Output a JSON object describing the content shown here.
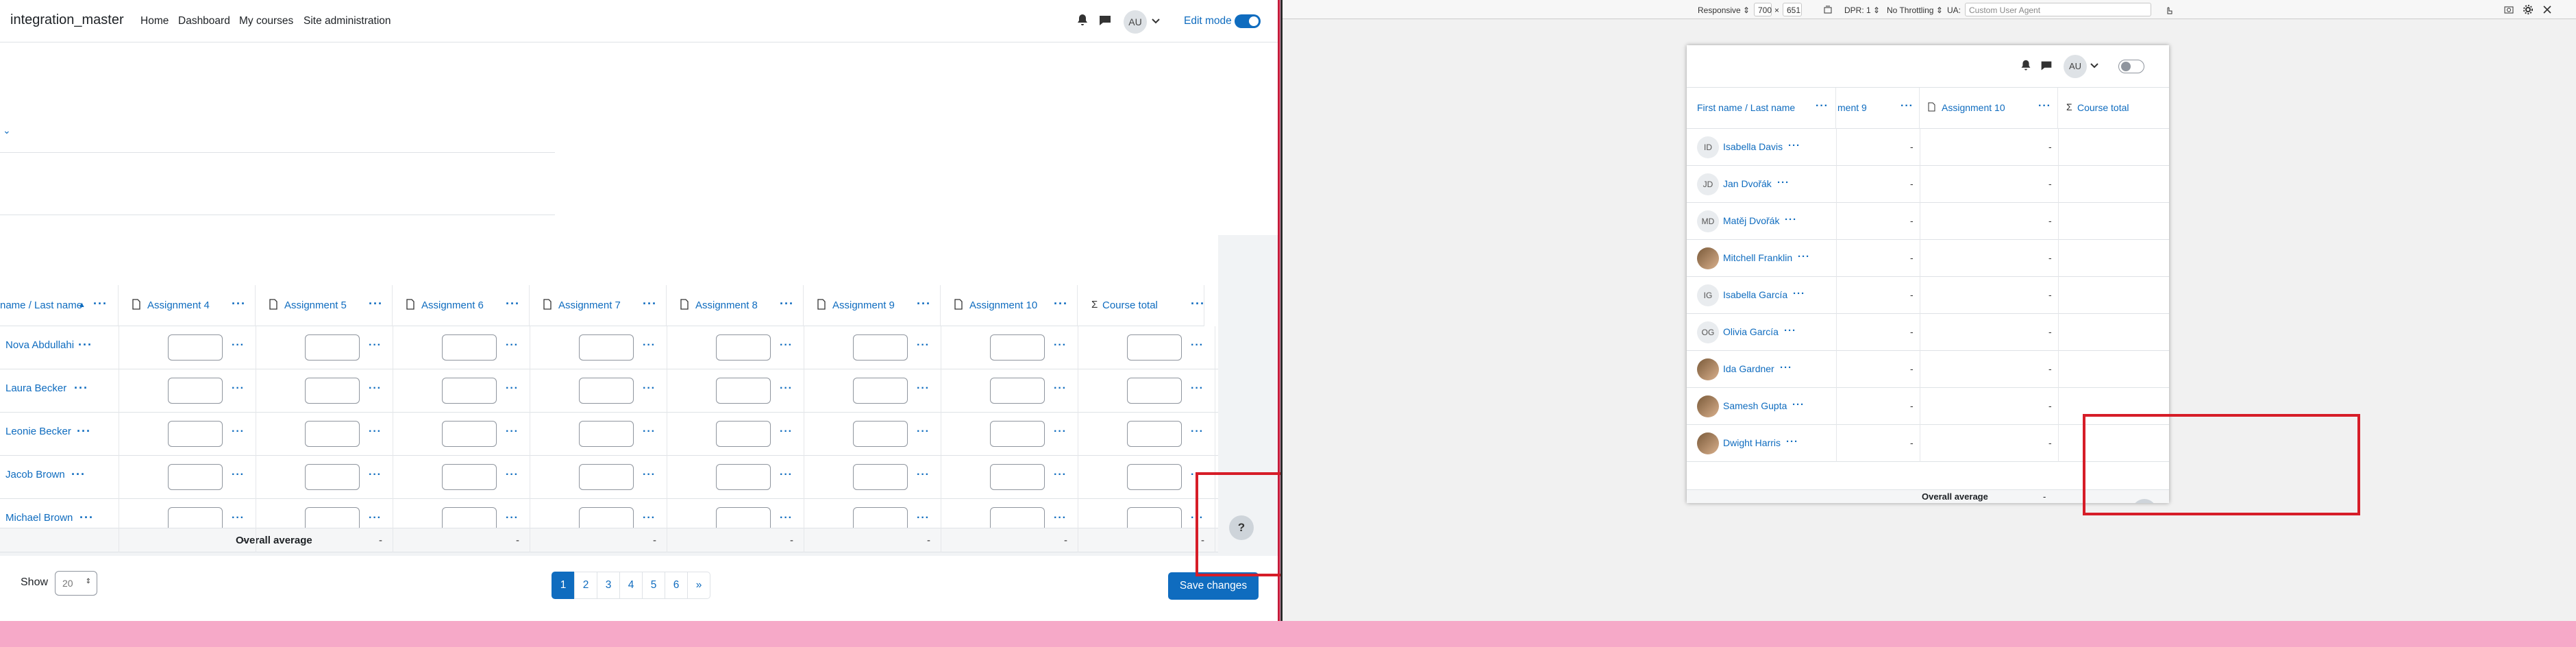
{
  "navbar": {
    "site_name": "integration_master",
    "links": [
      "Home",
      "Dashboard",
      "My courses",
      "Site administration"
    ],
    "avatar_initials": "AU",
    "edit_mode_label": "Edit mode",
    "edit_mode_on": true
  },
  "grader": {
    "name_header": "First name / Last name",
    "name_header_visible": "name / Last name",
    "sort_indicator": "▲",
    "columns": [
      "Assignment 4",
      "Assignment 5",
      "Assignment 6",
      "Assignment 7",
      "Assignment 8",
      "Assignment 9",
      "Assignment 10",
      "Course total"
    ],
    "students": [
      "Nova Abdullahi",
      "Laura Becker",
      "Leonie Becker",
      "Jacob Brown",
      "Michael Brown"
    ],
    "overall_average_label": "Overall average",
    "average_value": "-"
  },
  "footer": {
    "show_label": "Show",
    "per_page": "20",
    "pages": [
      "1",
      "2",
      "3",
      "4",
      "5",
      "6",
      "»"
    ],
    "active_page": "1",
    "save_label": "Save changes"
  },
  "help_label": "?",
  "devtools": {
    "mode": "Responsive ⇕",
    "width": "700",
    "times": "×",
    "height": "651",
    "dpr": "DPR: 1 ⇕",
    "throttle": "No Throttling ⇕",
    "ua_label": "UA:",
    "ua_placeholder": "Custom User Agent"
  },
  "responsive": {
    "avatar_initials": "AU",
    "name_header": "First name / Last name",
    "partial_col": "ment 9",
    "col_a10": "Assignment 10",
    "col_total": "Course total",
    "students": [
      {
        "initials": "ID",
        "name": "Isabella Davis",
        "photo": false
      },
      {
        "initials": "JD",
        "name": "Jan Dvořák",
        "photo": false
      },
      {
        "initials": "MD",
        "name": "Matěj Dvořák",
        "photo": false
      },
      {
        "initials": "",
        "name": "Mitchell Franklin",
        "photo": true
      },
      {
        "initials": "IG",
        "name": "Isabella García",
        "photo": false
      },
      {
        "initials": "OG",
        "name": "Olivia García",
        "photo": false
      },
      {
        "initials": "",
        "name": "Ida Gardner",
        "photo": true
      },
      {
        "initials": "",
        "name": "Samesh Gupta",
        "photo": true
      },
      {
        "initials": "",
        "name": "Dwight Harris",
        "photo": true
      }
    ],
    "overall_average_label": "Overall average",
    "average_value": "-",
    "dash": "-"
  },
  "colors": {
    "accent": "#0f6cbf",
    "highlight": "#d61d28",
    "backdrop": "#f6a9c8"
  }
}
